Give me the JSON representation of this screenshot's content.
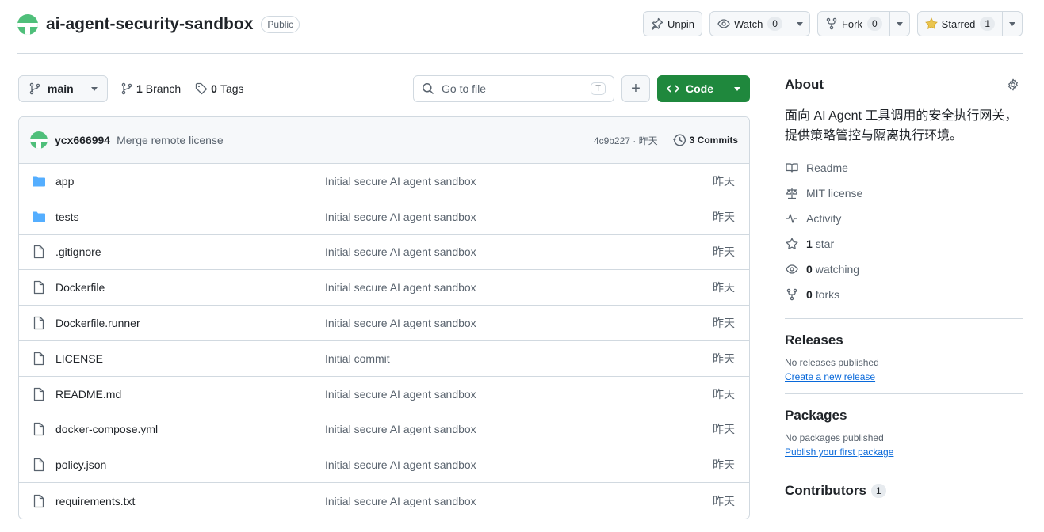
{
  "repo": {
    "name": "ai-agent-security-sandbox",
    "visibility": "Public"
  },
  "actions": {
    "unpin": "Unpin",
    "watch": "Watch",
    "watch_count": "0",
    "fork": "Fork",
    "fork_count": "0",
    "starred": "Starred",
    "star_count": "1"
  },
  "branch": {
    "current": "main",
    "branch_count": "1",
    "branch_label": "Branch",
    "tag_count": "0",
    "tag_label": "Tags"
  },
  "search": {
    "placeholder": "Go to file",
    "shortcut": "T"
  },
  "code_button": "Code",
  "latest_commit": {
    "author": "ycx666994",
    "message": "Merge remote license",
    "hash": "4c9b227 · 昨天",
    "commits_count": "3",
    "commits_label": "Commits"
  },
  "files": [
    {
      "name": "app",
      "type": "folder",
      "message": "Initial secure AI agent sandbox",
      "date": "昨天"
    },
    {
      "name": "tests",
      "type": "folder",
      "message": "Initial secure AI agent sandbox",
      "date": "昨天"
    },
    {
      "name": ".gitignore",
      "type": "file",
      "message": "Initial secure AI agent sandbox",
      "date": "昨天"
    },
    {
      "name": "Dockerfile",
      "type": "file",
      "message": "Initial secure AI agent sandbox",
      "date": "昨天"
    },
    {
      "name": "Dockerfile.runner",
      "type": "file",
      "message": "Initial secure AI agent sandbox",
      "date": "昨天"
    },
    {
      "name": "LICENSE",
      "type": "file",
      "message": "Initial commit",
      "date": "昨天"
    },
    {
      "name": "README.md",
      "type": "file",
      "message": "Initial secure AI agent sandbox",
      "date": "昨天"
    },
    {
      "name": "docker-compose.yml",
      "type": "file",
      "message": "Initial secure AI agent sandbox",
      "date": "昨天"
    },
    {
      "name": "policy.json",
      "type": "file",
      "message": "Initial secure AI agent sandbox",
      "date": "昨天"
    },
    {
      "name": "requirements.txt",
      "type": "file",
      "message": "Initial secure AI agent sandbox",
      "date": "昨天"
    }
  ],
  "about": {
    "title": "About",
    "description": "面向 AI Agent 工具调用的安全执行网关，提供策略管控与隔离执行环境。",
    "readme": "Readme",
    "license": "MIT license",
    "activity": "Activity",
    "stars_count": "1",
    "stars_label": "star",
    "watching_count": "0",
    "watching_label": "watching",
    "forks_count": "0",
    "forks_label": "forks"
  },
  "releases": {
    "title": "Releases",
    "empty": "No releases published",
    "link": "Create a new release"
  },
  "packages": {
    "title": "Packages",
    "empty": "No packages published",
    "link": "Publish your first package"
  },
  "contributors": {
    "title": "Contributors",
    "count": "1"
  },
  "colors": {
    "accent_green": "#1f883d",
    "link_blue": "#0969da",
    "folder_blue": "#54aeff",
    "star_yellow": "#eac54f"
  }
}
